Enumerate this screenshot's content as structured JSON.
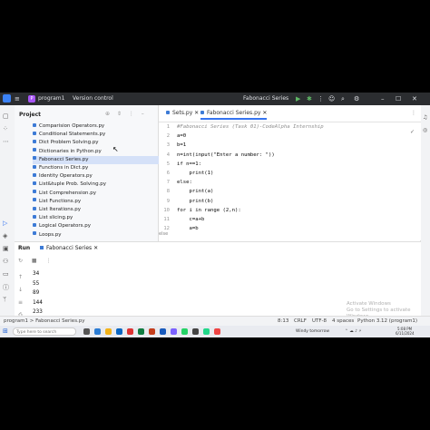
{
  "titlebar": {
    "project_initial": "P",
    "project_name": "program1",
    "vcs": "Version control",
    "run_config": "Fabonacci Series"
  },
  "project_panel": {
    "title": "Project",
    "files": [
      "Comparision Operators.py",
      "Conditional Statements.py",
      "Dict Problem Solving.py",
      "Dictionaries in Python.py",
      "Fabonacci Series.py",
      "Functions in Dict.py",
      "Identity Operators.py",
      "List&tuple Prob. Solving.py",
      "List Comprehension.py",
      "List Functions.py",
      "List Iterations.py",
      "List slicing.py",
      "Logical Operators.py",
      "Loops.py"
    ],
    "selected_index": 4
  },
  "editor": {
    "tabs": [
      "Sets.py",
      "Fabonacci Series.py"
    ],
    "active_tab": 1,
    "lines": [
      {
        "n": "1",
        "text": "#Fabonacci Series (Task 01)-CodeAlpha Internship",
        "comment": true
      },
      {
        "n": "2",
        "text": "a=0"
      },
      {
        "n": "3",
        "text": "b=1"
      },
      {
        "n": "4",
        "text": "n=int(input(\"Enter a number: \"))"
      },
      {
        "n": "5",
        "text": "if n==1:"
      },
      {
        "n": "6",
        "text": "    print(1)"
      },
      {
        "n": "7",
        "text": "else:"
      },
      {
        "n": "8",
        "text": "    print(a)"
      },
      {
        "n": "9",
        "text": "    print(b)"
      },
      {
        "n": "10",
        "text": "for i in range (2,n):"
      },
      {
        "n": "11",
        "text": "    c=a+b"
      },
      {
        "n": "12",
        "text": "    a=b"
      }
    ],
    "breadcrumb": "else"
  },
  "run_panel": {
    "label": "Run",
    "tab": "Fabonacci Series",
    "output": [
      "34",
      "55",
      "89",
      "144",
      "233"
    ]
  },
  "watermark": {
    "line1": "Activate Windows",
    "line2": "Go to Settings to activate Windows."
  },
  "statusbar": {
    "path": "program1 > Fabonacci Series.py",
    "position": "8:13",
    "line_sep": "CRLF",
    "encoding": "UTF-8",
    "indent": "4 spaces",
    "interpreter": "Python 3.12 (program1)"
  },
  "taskbar": {
    "search_placeholder": "Type here to search",
    "weather": "Windy tomorrow",
    "time": "5:08 PM",
    "date": "6/11/2024"
  },
  "colors": {
    "titlebar": "#2b2d30",
    "accent": "#3574f0",
    "selection": "#d5e1f8"
  }
}
